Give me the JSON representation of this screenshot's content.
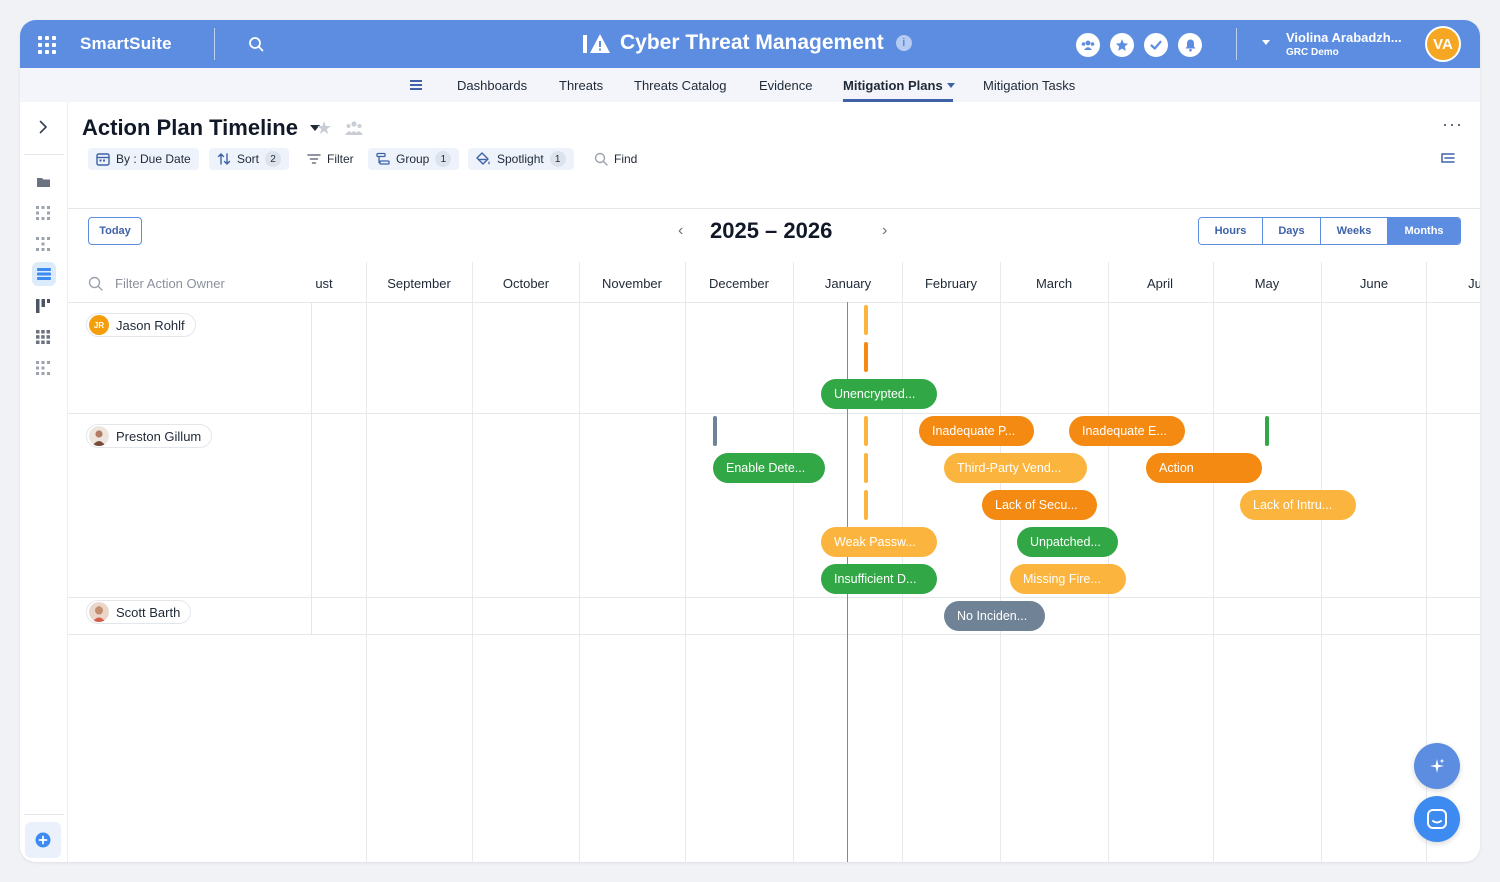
{
  "app": {
    "brand": "SmartSuite",
    "title": "Cyber Threat Management",
    "info_glyph": "i"
  },
  "user": {
    "name": "Violina Arabadzh...",
    "org": "GRC Demo",
    "initials": "VA"
  },
  "nav": {
    "tabs": [
      {
        "label": "Dashboards"
      },
      {
        "label": "Threats"
      },
      {
        "label": "Threats Catalog"
      },
      {
        "label": "Evidence"
      },
      {
        "label": "Mitigation Plans"
      },
      {
        "label": "Mitigation Tasks"
      }
    ],
    "active_index": 4
  },
  "view": {
    "title": "Action Plan Timeline",
    "more": "···"
  },
  "toolbar": {
    "by_label": "By : Due Date",
    "sort_label": "Sort",
    "sort_count": "2",
    "filter_label": "Filter",
    "group_label": "Group",
    "group_count": "1",
    "spotlight_label": "Spotlight",
    "spotlight_count": "1",
    "find_label": "Find"
  },
  "timeline": {
    "today_label": "Today",
    "range_label": "2025 – 2026",
    "prev_glyph": "‹",
    "next_glyph": "›",
    "scales": [
      "Hours",
      "Days",
      "Weeks",
      "Months"
    ],
    "active_scale": "Months",
    "filter_placeholder": "Filter Action Owner",
    "months": [
      "ust",
      "September",
      "October",
      "November",
      "December",
      "January",
      "February",
      "March",
      "April",
      "May",
      "June",
      "Ju"
    ]
  },
  "owners": [
    {
      "name": "Jason Rohlf",
      "initials": "JR"
    },
    {
      "name": "Preston Gillum"
    },
    {
      "name": "Scott Barth"
    }
  ],
  "bars": [
    {
      "label": "Unencrypted...",
      "color": "green"
    },
    {
      "label": "Inadequate P...",
      "color": "orange"
    },
    {
      "label": "Inadequate E...",
      "color": "orange"
    },
    {
      "label": "Enable Dete...",
      "color": "green"
    },
    {
      "label": "Third-Party Vend...",
      "color": "amber"
    },
    {
      "label": "Action",
      "color": "orange"
    },
    {
      "label": "Lack of Secu...",
      "color": "orange"
    },
    {
      "label": "Lack of Intru...",
      "color": "amber"
    },
    {
      "label": "Weak Passw...",
      "color": "amber"
    },
    {
      "label": "Unpatched...",
      "color": "green"
    },
    {
      "label": "Insufficient D...",
      "color": "green"
    },
    {
      "label": "Missing Fire...",
      "color": "amber"
    },
    {
      "label": "No Inciden...",
      "color": "slate"
    }
  ],
  "colors": {
    "topbar": "#5c8de0",
    "accent": "#3d62a8",
    "green": "#31a845",
    "orange": "#f58a12",
    "amber": "#fbb43d",
    "slate": "#6f8296"
  },
  "icons": {
    "apps": "apps-grid-icon",
    "search": "search-icon",
    "team": "team-icon",
    "favorites": "star-icon",
    "tasks": "check-icon",
    "notifications": "bell-icon",
    "ai": "sparkle-icon",
    "chat": "chat-icon"
  }
}
